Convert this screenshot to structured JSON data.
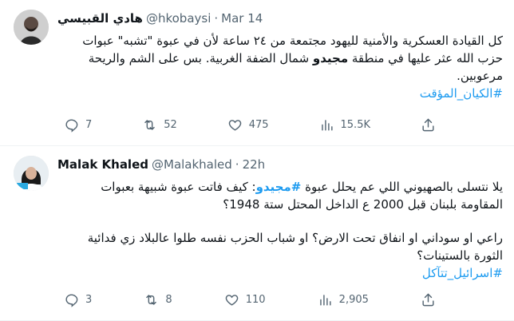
{
  "tweets": [
    {
      "name": "هادي القبيسي",
      "handle": "@hkobaysi",
      "separator": "·",
      "time": "Mar 14",
      "text_line1": "كل القيادة العسكرية والأمنية لليهود مجتمعة من ٢٤ ساعة لأن في عبوة \"تشبه\" عبوات",
      "text_line2_pre": "حزب الله عثر عليها في منطقة ",
      "text_line2_kw": "مجيدو",
      "text_line2_post": " شمال الضفة الغربية. بس على الشم والريحة",
      "text_line3": "مرعوبين.",
      "hashtag": "#الكيان_المؤقت",
      "replies": "7",
      "retweets": "52",
      "likes": "475",
      "views": "15.5K"
    },
    {
      "name": "Malak Khaled",
      "handle": "@Malakhaled",
      "separator": "·",
      "time": "22h",
      "text_line1_pre": "يلا نتسلى بالصهيوني اللي عم يحلل عبوة ",
      "text_line1_tag": "#مجيدو",
      "text_line1_post": ": كيف فاتت عبوة شبيهة بعبوات",
      "text_line2": "المقاومة بلبنان قبل 2000 ع الداخل المحتل ستة 1948؟",
      "text_line3": "راعي او سوداني او انفاق تحت الارض؟ او شباب الحزب نفسه طلوا عالبلاد  زي فدائية",
      "text_line4": "الثورة بالستينات؟",
      "hashtag": "#اسرائيل_تتآكل",
      "replies": "3",
      "retweets": "8",
      "likes": "110",
      "views": "2,905"
    }
  ],
  "icons": [
    "reply-icon",
    "retweet-icon",
    "like-icon",
    "views-icon",
    "share-icon"
  ],
  "colors": {
    "link": "#1d9bf0",
    "muted": "#536471",
    "text": "#0f1419"
  }
}
